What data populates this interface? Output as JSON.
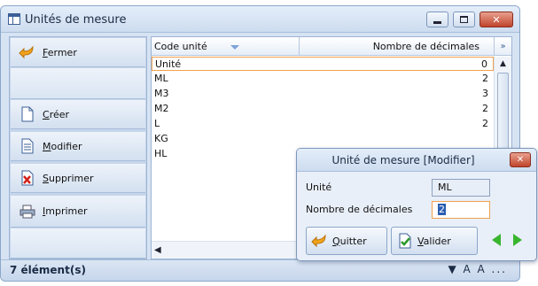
{
  "window": {
    "title": "Unités de mesure",
    "minimize": "–",
    "maximize": "□",
    "close": "✕"
  },
  "sidebar": {
    "buttons": [
      {
        "label": "Fermer",
        "icon": "back-arrow-icon"
      },
      {
        "label": "Créer",
        "icon": "new-document-icon"
      },
      {
        "label": "Modifier",
        "icon": "edit-document-icon"
      },
      {
        "label": "Supprimer",
        "icon": "delete-document-icon"
      },
      {
        "label": "Imprimer",
        "icon": "printer-icon"
      }
    ]
  },
  "grid": {
    "columns": {
      "code": "Code unité",
      "decimals": "Nombre de décimales"
    },
    "column_chooser": "»",
    "rows": [
      {
        "code": "Unité",
        "decimals": "0"
      },
      {
        "code": "ML",
        "decimals": "2"
      },
      {
        "code": "M3",
        "decimals": "3"
      },
      {
        "code": "M2",
        "decimals": "2"
      },
      {
        "code": "L",
        "decimals": "2"
      },
      {
        "code": "KG",
        "decimals": ""
      },
      {
        "code": "HL",
        "decimals": ""
      }
    ],
    "scroll_up": "▲",
    "scroll_left": "◀"
  },
  "status": {
    "count_text": "7 élément(s)",
    "tools_text": "▼ A A ..."
  },
  "dialog": {
    "title": "Unité de mesure [Modifier]",
    "close": "✕",
    "fields": {
      "unit_label": "Unité",
      "unit_value": "ML",
      "decimals_label": "Nombre de décimales",
      "decimals_value": "2"
    },
    "buttons": {
      "quit": "Quitter",
      "validate": "Valider"
    }
  },
  "colors": {
    "accent_orange": "#f0a050",
    "panel_blue": "#d6e3f3",
    "nav_green": "#39b530"
  }
}
